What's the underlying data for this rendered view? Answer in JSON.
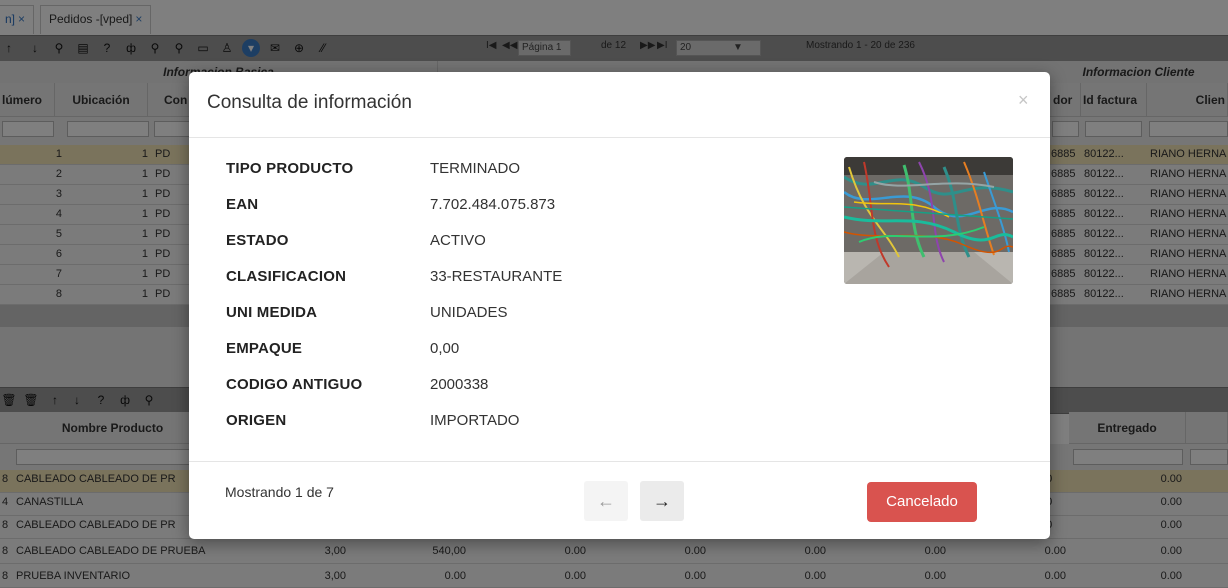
{
  "tabs": [
    {
      "label": "n]",
      "close": "×"
    },
    {
      "label": "Pedidos -[vped]",
      "close": "×"
    }
  ],
  "pager": {
    "first": "I◀",
    "prev": "◀◀",
    "page_label": "Página 1",
    "of_label": "de 12",
    "next": "▶▶",
    "last": "▶I",
    "page_size": "20",
    "chevron": "▼",
    "showing": "Mostrando 1 - 20 de 236"
  },
  "grid_top": {
    "group_headers": {
      "basic": "Informacion Basica",
      "client": "Informacion Cliente"
    },
    "columns": {
      "numero": "lúmero",
      "ubicacion": "Ubicación",
      "con": "Con",
      "dor": "dor",
      "id_factura": "Id factura",
      "cliente": "Clien"
    },
    "rows": [
      {
        "n": "1",
        "u": "1",
        "c": "PD",
        "d": "6885",
        "f": "80122...",
        "cl": "RIANO HERNA"
      },
      {
        "n": "2",
        "u": "1",
        "c": "PD",
        "d": "6885",
        "f": "80122...",
        "cl": "RIANO HERNA"
      },
      {
        "n": "3",
        "u": "1",
        "c": "PD",
        "d": "6885",
        "f": "80122...",
        "cl": "RIANO HERNA"
      },
      {
        "n": "4",
        "u": "1",
        "c": "PD",
        "d": "6885",
        "f": "80122...",
        "cl": "RIANO HERNA"
      },
      {
        "n": "5",
        "u": "1",
        "c": "PD",
        "d": "6885",
        "f": "80122...",
        "cl": "RIANO HERNA"
      },
      {
        "n": "6",
        "u": "1",
        "c": "PD",
        "d": "6885",
        "f": "80122...",
        "cl": "RIANO HERNA"
      },
      {
        "n": "7",
        "u": "1",
        "c": "PD",
        "d": "6885",
        "f": "80122...",
        "cl": "RIANO HERNA"
      },
      {
        "n": "8",
        "u": "1",
        "c": "PD",
        "d": "6885",
        "f": "80122...",
        "cl": "RIANO HERNA"
      }
    ]
  },
  "grid_bottom": {
    "columns": {
      "nombre": "Nombre Producto",
      "entregado": "Entregado"
    },
    "rows": [
      {
        "id": "8",
        "nombre": "CABLEADO CABLEADO DE PR",
        "a": "",
        "b": "",
        "c": "",
        "d": "",
        "e": "",
        "f": "",
        "g": "00",
        "h": "0.00"
      },
      {
        "id": "4",
        "nombre": "CANASTILLA",
        "a": "",
        "b": "",
        "c": "",
        "d": "",
        "e": "",
        "f": "",
        "g": "00",
        "h": "0.00"
      },
      {
        "id": "8",
        "nombre": "CABLEADO CABLEADO DE PR",
        "a": "",
        "b": "",
        "c": "",
        "d": "",
        "e": "",
        "f": "",
        "g": "00",
        "h": "0.00"
      },
      {
        "id": "8",
        "nombre": "CABLEADO CABLEADO DE PRUEBA",
        "a": "3,00",
        "b": "540,00",
        "c": "0.00",
        "d": "0.00",
        "e": "0.00",
        "f": "0.00",
        "g": "0.00",
        "h": "0.00"
      },
      {
        "id": "8",
        "nombre": "PRUEBA INVENTARIO",
        "a": "3,00",
        "b": "0.00",
        "c": "0.00",
        "d": "0.00",
        "e": "0.00",
        "f": "0.00",
        "g": "0.00",
        "h": "0.00"
      }
    ]
  },
  "modal": {
    "title": "Consulta de información",
    "close": "×",
    "fields": [
      {
        "label": "TIPO PRODUCTO",
        "value": "TERMINADO"
      },
      {
        "label": "EAN",
        "value": "7.702.484.075.873"
      },
      {
        "label": "ESTADO",
        "value": "ACTIVO"
      },
      {
        "label": "CLASIFICACION",
        "value": "33-RESTAURANTE"
      },
      {
        "label": "UNI MEDIDA",
        "value": "UNIDADES"
      },
      {
        "label": "EMPAQUE",
        "value": "0,00"
      },
      {
        "label": "CODIGO ANTIGUO",
        "value": "2000338"
      },
      {
        "label": "ORIGEN",
        "value": "IMPORTADO"
      }
    ],
    "showing": "Mostrando 1 de 7",
    "prev_icon": "←",
    "next_icon": "→",
    "cancel_label": "Cancelado"
  },
  "colors": {
    "accent": "#3b7cc7",
    "cancel": "#d9534f",
    "selected_row": "#f5e6b8"
  }
}
